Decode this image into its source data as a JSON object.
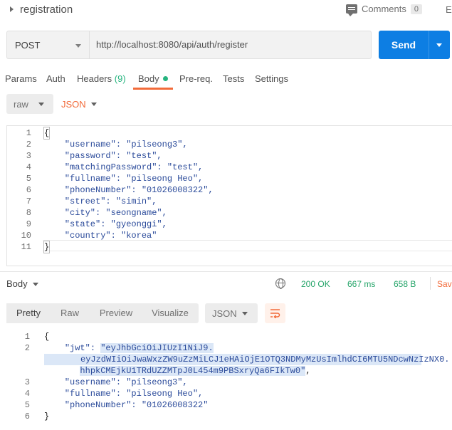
{
  "header": {
    "request_name": "registration",
    "comments_label": "Comments",
    "comments_count": "0",
    "examples_label": "Ex"
  },
  "request": {
    "method": "POST",
    "url": "http://localhost:8080/api/auth/register",
    "send_label": "Send"
  },
  "tabs": {
    "params": "Params",
    "auth": "Auth",
    "headers": "Headers",
    "headers_count": "(9)",
    "body": "Body",
    "prereq": "Pre-req.",
    "tests": "Tests",
    "settings": "Settings"
  },
  "body_options": {
    "mode": "raw",
    "language": "JSON"
  },
  "request_body_lines": [
    "{",
    "    \"username\": \"pilseong3\",",
    "    \"password\": \"test\",",
    "    \"matchingPassword\": \"test\",",
    "    \"fullname\": \"pilseong Heo\",",
    "    \"phoneNumber\": \"01026008322\",",
    "    \"street\": \"simin\",",
    "    \"city\": \"seongname\",",
    "    \"state\": \"gyeonggi\",",
    "    \"country\": \"korea\"",
    "}"
  ],
  "request_line_numbers": [
    "1",
    "2",
    "3",
    "4",
    "5",
    "6",
    "7",
    "8",
    "9",
    "10",
    "11"
  ],
  "response": {
    "body_label": "Body",
    "status": "200 OK",
    "time": "667 ms",
    "size": "658 B",
    "save_label": "Sav",
    "view_tabs": [
      "Pretty",
      "Raw",
      "Preview",
      "Visualize"
    ],
    "format": "JSON",
    "line_numbers": [
      "1",
      "2",
      "",
      "",
      "3",
      "4",
      "5",
      "6"
    ],
    "jwt_key": "\"jwt\": ",
    "jwt_part1": "\"eyJhbGciOiJIUzI1NiJ9.",
    "jwt_part2": "eyJzdWIiOiJwaWxzZW9uZzMiLCJ1eHAiOjE1OTQ3NDMyMzUsImlhdCI6MTU5NDcwNzIzNX0.",
    "jwt_part3": "hhpkCMEjkU1TRdUZZMTpJ0L454m9PBSxryQa6FIkTw0\"",
    "lines": {
      "open": "{",
      "username": "    \"username\": \"pilseong3\",",
      "fullname": "    \"fullname\": \"pilseong Heo\",",
      "phone": "    \"phoneNumber\": \"01026008322\"",
      "close": "}"
    }
  },
  "colors": {
    "send": "#0d7ee3",
    "accent": "#f26b3a",
    "success": "#26a56a"
  }
}
